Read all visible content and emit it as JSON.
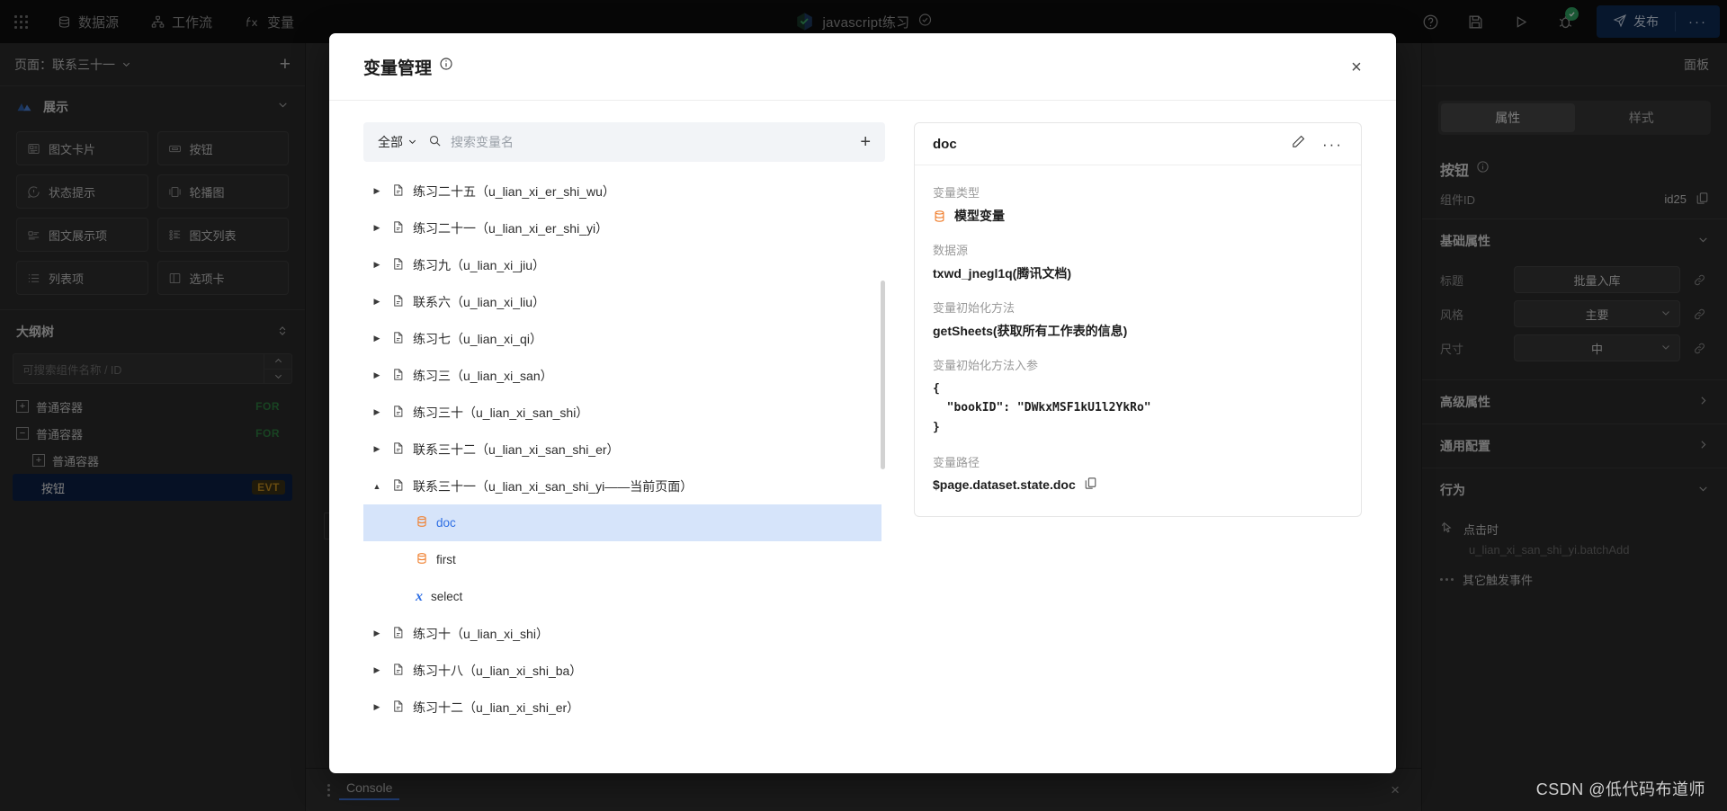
{
  "topbar": {
    "menu": [
      {
        "label": "数据源",
        "icon": "database-icon"
      },
      {
        "label": "工作流",
        "icon": "workflow-icon"
      },
      {
        "label": "变量",
        "icon": "fx-icon"
      }
    ],
    "project_title": "javascript练习",
    "publish_label": "发布",
    "more_label": "···",
    "icons": [
      "help-icon",
      "save-icon",
      "run-icon",
      "debug-icon"
    ]
  },
  "left_panel": {
    "page_label": "页面：联系三十一",
    "add_page_label": "+",
    "display_section": "展示",
    "components": [
      "图文卡片",
      "按钮",
      "状态提示",
      "轮播图",
      "图文展示项",
      "图文列表",
      "列表项",
      "选项卡"
    ],
    "outline_title": "大纲树",
    "outline_search_placeholder": "可搜索组件名称 / ID",
    "tree": [
      {
        "label": "普通容器",
        "toggle": "+",
        "tag": "FOR",
        "tag_type": "for",
        "indent": 0,
        "selected": false
      },
      {
        "label": "普通容器",
        "toggle": "−",
        "tag": "FOR",
        "tag_type": "for",
        "indent": 0,
        "selected": false
      },
      {
        "label": "普通容器",
        "toggle": "+",
        "tag": "",
        "tag_type": "",
        "indent": 1,
        "selected": false
      },
      {
        "label": "按钮",
        "toggle": "",
        "tag": "EVT",
        "tag_type": "evt",
        "indent": 2,
        "selected": true
      }
    ]
  },
  "right_panel": {
    "panel_label": "面板",
    "tabs": [
      {
        "label": "属性",
        "active": true
      },
      {
        "label": "样式",
        "active": false
      }
    ],
    "component_title": "按钮",
    "component_id_label": "组件ID",
    "component_id_value": "id25",
    "groups": [
      {
        "title": "基础属性",
        "chevron": "v"
      },
      {
        "title": "高级属性",
        "chevron": ">"
      },
      {
        "title": "通用配置",
        "chevron": ">"
      },
      {
        "title": "行为",
        "chevron": "v"
      }
    ],
    "fields": [
      {
        "label": "标题",
        "value": "批量入库",
        "type": "text"
      },
      {
        "label": "风格",
        "value": "主要",
        "type": "select"
      },
      {
        "label": "尺寸",
        "value": "中",
        "type": "select"
      }
    ],
    "events": {
      "on_click_label": "点击时",
      "on_click_value": "u_lian_xi_san_shi_yi.batchAdd",
      "other_events_label": "其它触发事件"
    }
  },
  "bottom_bar": {
    "console_label": "Console",
    "close_label": "×"
  },
  "watermark": "CSDN @低代码布道师",
  "modal": {
    "title": "变量管理",
    "close_label": "×",
    "filter": {
      "all_label": "全部",
      "search_placeholder": "搜索变量名",
      "add_label": "+"
    },
    "variable_list": [
      {
        "name": "练习二十五（u_lian_xi_er_shi_wu）",
        "type": "page",
        "expanded": false,
        "level": 0
      },
      {
        "name": "练习二十一（u_lian_xi_er_shi_yi）",
        "type": "page",
        "expanded": false,
        "level": 0
      },
      {
        "name": "练习九（u_lian_xi_jiu）",
        "type": "page",
        "expanded": false,
        "level": 0
      },
      {
        "name": "联系六（u_lian_xi_liu）",
        "type": "page",
        "expanded": false,
        "level": 0
      },
      {
        "name": "练习七（u_lian_xi_qi）",
        "type": "page",
        "expanded": false,
        "level": 0
      },
      {
        "name": "练习三（u_lian_xi_san）",
        "type": "page",
        "expanded": false,
        "level": 0
      },
      {
        "name": "练习三十（u_lian_xi_san_shi）",
        "type": "page",
        "expanded": false,
        "level": 0
      },
      {
        "name": "联系三十二（u_lian_xi_san_shi_er）",
        "type": "page",
        "expanded": false,
        "level": 0
      },
      {
        "name": "联系三十一（u_lian_xi_san_shi_yi——当前页面）",
        "type": "page",
        "expanded": true,
        "level": 0
      },
      {
        "name": "doc",
        "type": "model",
        "level": 1,
        "selected": true
      },
      {
        "name": "first",
        "type": "model",
        "level": 1,
        "selected": false
      },
      {
        "name": "select",
        "type": "expression",
        "level": 1,
        "selected": false
      },
      {
        "name": "练习十（u_lian_xi_shi）",
        "type": "page",
        "expanded": false,
        "level": 0
      },
      {
        "name": "练习十八（u_lian_xi_shi_ba）",
        "type": "page",
        "expanded": false,
        "level": 0
      },
      {
        "name": "练习十二（u_lian_xi_shi_er）",
        "type": "page",
        "expanded": false,
        "level": 0
      }
    ],
    "detail": {
      "name": "doc",
      "edit_icon": "pencil-icon",
      "more_icon": "ellipsis-icon",
      "sections": [
        {
          "label": "变量类型",
          "value": "模型变量",
          "icon": "model-icon"
        },
        {
          "label": "数据源",
          "value": "txwd_jnegl1q(腾讯文档)",
          "icon": ""
        },
        {
          "label": "变量初始化方法",
          "value": "getSheets(获取所有工作表的信息)",
          "icon": ""
        }
      ],
      "params_label": "变量初始化方法入参",
      "params_value": "{\n  \"bookID\": \"DWkxMSF1kU1l2YkRo\"\n}",
      "path_label": "变量路径",
      "path_value": "$page.dataset.state.doc",
      "copy_icon": "copy-icon"
    }
  },
  "colors": {
    "accent_blue": "#2f6fe4",
    "selection_blue": "#d6e4fa",
    "orange": "#f08030",
    "publish_bg": "#0d2a52",
    "for_tag": "#2d7a3e",
    "evt_tag": "#c08a1f"
  }
}
